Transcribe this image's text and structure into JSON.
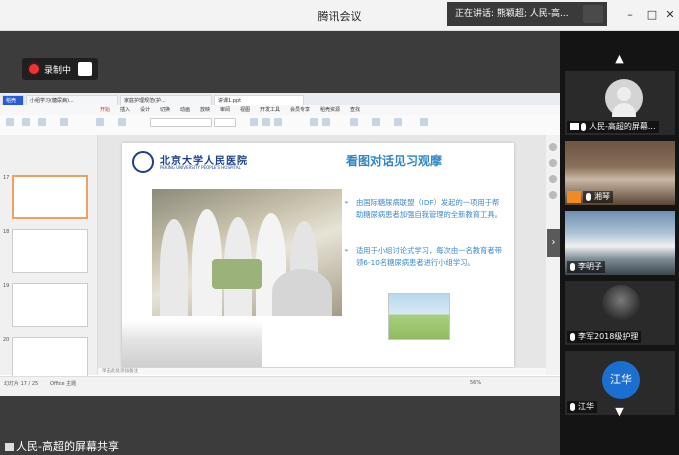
{
  "app": {
    "title": "腾讯会议",
    "speaking": "正在讲话: 熊颖超; 人民-高..."
  },
  "recording": {
    "label": "录制中"
  },
  "share": {
    "label": "人民-高超的屏幕共享"
  },
  "wps": {
    "tabs": [
      "稻壳",
      "小组学习(糖尿病)...",
      "家庭护理规范(护...",
      "讲课1.ppt"
    ],
    "menu": [
      "开始",
      "插入",
      "设计",
      "切换",
      "动画",
      "放映",
      "审阅",
      "视图",
      "开发工具",
      "会员专享",
      "稻壳资源",
      "查找"
    ],
    "slide_numbers": [
      "17",
      "18",
      "19",
      "20"
    ],
    "notes_placeholder": "单击此处添加备注",
    "status_left": "幻灯片 17 / 25",
    "status_mid": "Office 主题",
    "zoom": "56%"
  },
  "slide": {
    "logo_cn": "北京大学人民医院",
    "logo_en": "PEKING UNIVERSITY PEOPLE'S HOSPITAL",
    "title": "看图对话见习观摩",
    "bullets": [
      "由国际糖尿病联盟（IDF）发起的一项用于帮助糖尿病患者加强自我管理的全新教育工具。",
      "适用于小组讨论式学习，每次由一名教育者带领6-10名糖尿病患者进行小组学习。"
    ]
  },
  "participants": [
    {
      "name": "人民-高超的屏幕...",
      "avatar": "gray-avatar-icon"
    },
    {
      "name": "湘琴"
    },
    {
      "name": "李明子"
    },
    {
      "name": "李军2018级护理"
    },
    {
      "name": "江华",
      "avatar_text": "江华"
    }
  ],
  "colors": {
    "accent": "#2f86c6",
    "record": "#ee3333",
    "sidebar": "#141414",
    "avatar_blue": "#1a6fd0"
  }
}
